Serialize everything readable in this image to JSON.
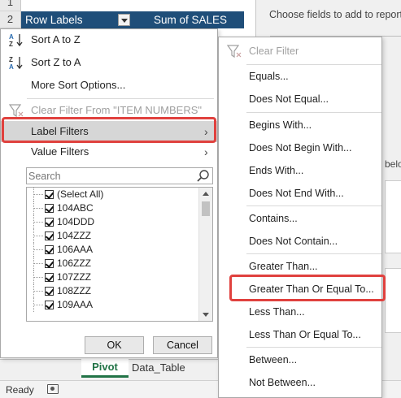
{
  "sheet": {
    "row_numbers": [
      "1",
      "2"
    ],
    "pivot_header": {
      "row_labels": "Row Labels",
      "sum_label": "Sum of SALES"
    }
  },
  "taskpane": {
    "choose_fields": "Choose fields to add to report:",
    "below_fragment": "belo"
  },
  "filter_menu": {
    "sort_az": "Sort A to Z",
    "sort_za": "Sort Z to A",
    "more_sort": "More Sort Options...",
    "clear_filter": "Clear Filter From \"ITEM NUMBERS\"",
    "label_filters": "Label Filters",
    "value_filters": "Value Filters",
    "search_placeholder": "Search",
    "items": [
      "(Select All)",
      "104ABC",
      "104DDD",
      "104ZZZ",
      "106AAA",
      "106ZZZ",
      "107ZZZ",
      "108ZZZ",
      "109AAA"
    ],
    "ok": "OK",
    "cancel": "Cancel"
  },
  "label_filter_submenu": {
    "clear_filter": "Clear Filter",
    "equals": "Equals...",
    "does_not_equal": "Does Not Equal...",
    "begins_with": "Begins With...",
    "does_not_begin_with": "Does Not Begin With...",
    "ends_with": "Ends With...",
    "does_not_end_with": "Does Not End With...",
    "contains": "Contains...",
    "does_not_contain": "Does Not Contain...",
    "greater_than": "Greater Than...",
    "greater_than_or_equal": "Greater Than Or Equal To...",
    "less_than": "Less Than...",
    "less_than_or_equal": "Less Than Or Equal To...",
    "between": "Between...",
    "not_between": "Not Between..."
  },
  "tabs": {
    "pivot": "Pivot",
    "data_table": "Data_Table"
  },
  "status": {
    "ready": "Ready"
  },
  "colors": {
    "pivot_header_bg": "#1f4e79",
    "highlight": "#e0413e",
    "active_tab": "#217346"
  }
}
